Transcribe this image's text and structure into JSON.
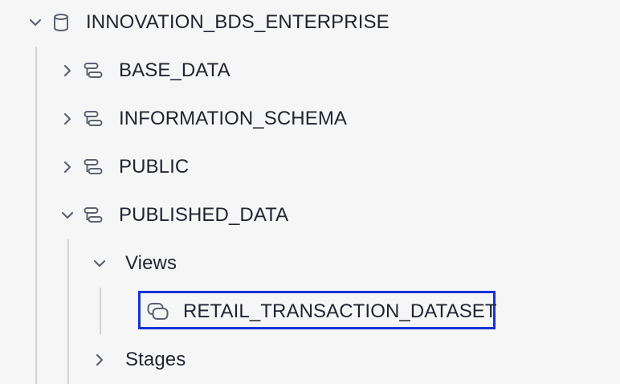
{
  "tree": {
    "database": {
      "label": "INNOVATION_BDS_ENTERPRISE",
      "icon": "database-icon",
      "expanded": true
    },
    "schemas": [
      {
        "label": "BASE_DATA",
        "icon": "schema-icon",
        "expanded": false
      },
      {
        "label": "INFORMATION_SCHEMA",
        "icon": "schema-icon",
        "expanded": false
      },
      {
        "label": "PUBLIC",
        "icon": "schema-icon",
        "expanded": false
      },
      {
        "label": "PUBLISHED_DATA",
        "icon": "schema-icon",
        "expanded": true
      }
    ],
    "published_children": {
      "views": {
        "label": "Views",
        "expanded": true
      },
      "view_items": [
        {
          "label": "RETAIL_TRANSACTION_DATASET",
          "icon": "view-icon",
          "selected": true
        }
      ],
      "stages": {
        "label": "Stages",
        "expanded": false
      }
    }
  },
  "colors": {
    "background": "#f6f6f6",
    "text": "#1f2430",
    "icon": "#5b6270",
    "guide_line": "#d2d4d8",
    "selection_border": "#1533d6"
  }
}
